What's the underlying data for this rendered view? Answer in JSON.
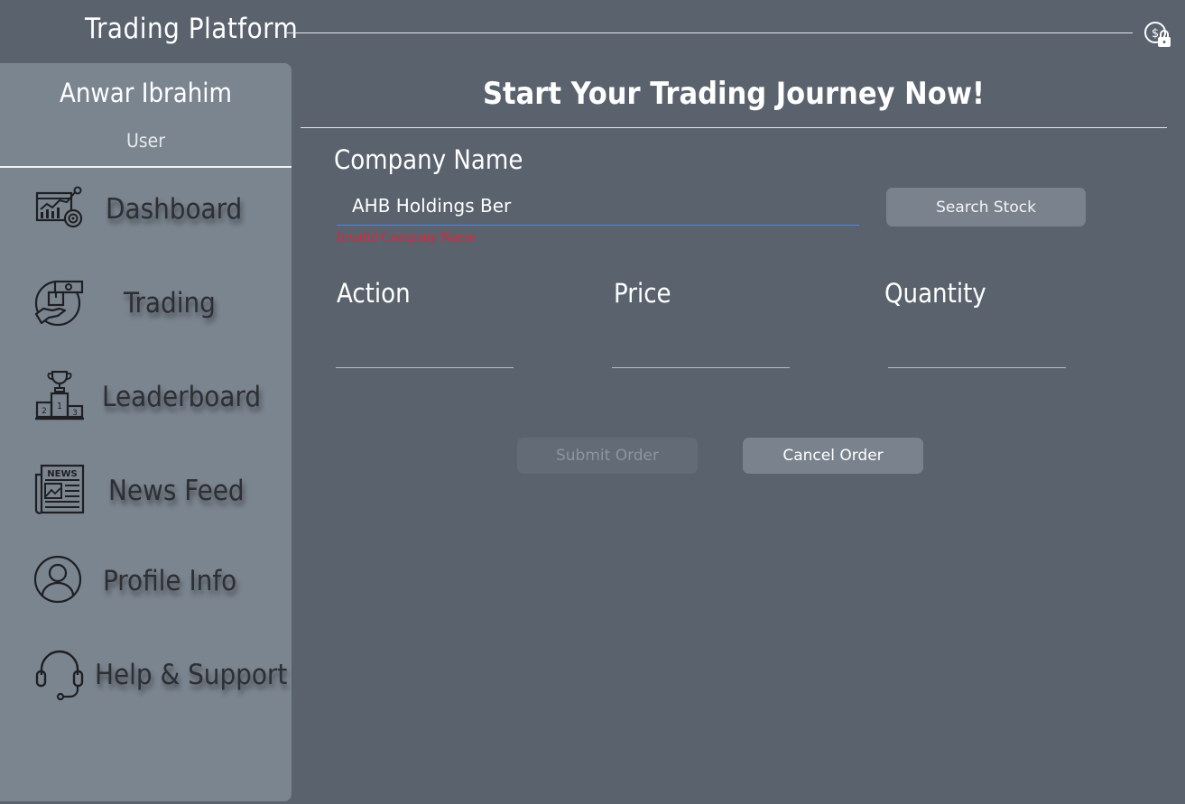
{
  "app": {
    "title": "Trading Platform",
    "logout_icon": "dollar-lock-icon"
  },
  "sidebar": {
    "user_name": "Anwar Ibrahim",
    "user_role": "User",
    "items": [
      {
        "label": "Dashboard",
        "icon": "dashboard-chart-icon"
      },
      {
        "label": "Trading",
        "icon": "trading-hand-icon"
      },
      {
        "label": "Leaderboard",
        "icon": "podium-trophy-icon"
      },
      {
        "label": "News Feed",
        "icon": "newspaper-icon"
      },
      {
        "label": "Profile Info",
        "icon": "user-profile-icon"
      },
      {
        "label": "Help & Support",
        "icon": "headset-icon"
      }
    ]
  },
  "main": {
    "heading": "Start Your Trading Journey Now!",
    "company": {
      "label": "Company Name",
      "value": "AHB Holdings Ber",
      "error": "Invalid Company Name"
    },
    "search_button": "Search Stock",
    "action": {
      "label": "Action",
      "value": ""
    },
    "price": {
      "label": "Price",
      "value": ""
    },
    "quantity": {
      "label": "Quantity",
      "value": ""
    },
    "submit_button": "Submit Order",
    "cancel_button": "Cancel Order"
  },
  "colors": {
    "background": "#59626d",
    "sidebar": "#7b8590",
    "error": "#e0253a",
    "input_focus": "#4a86e8",
    "button": "#7a838d",
    "button_disabled": "#636c76"
  }
}
